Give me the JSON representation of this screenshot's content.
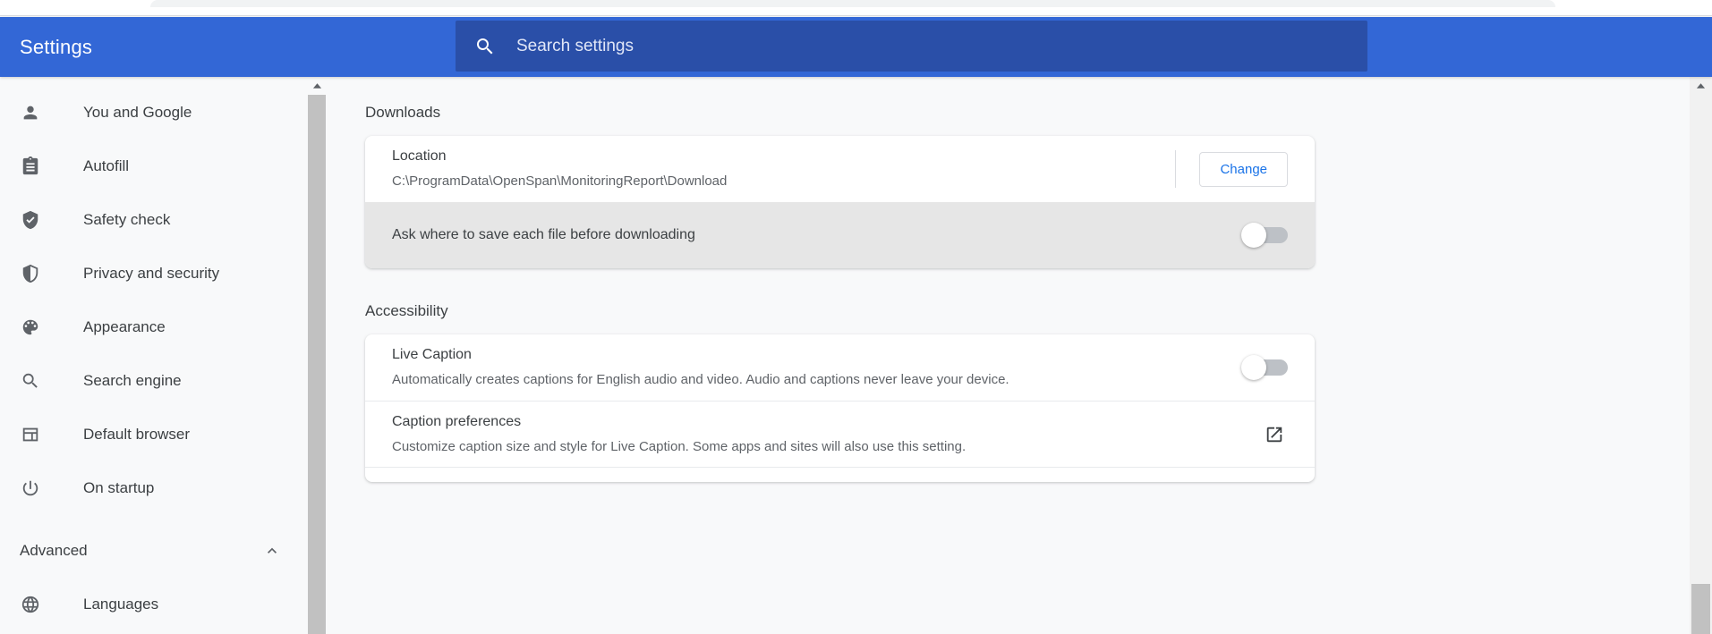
{
  "header": {
    "title": "Settings",
    "search": {
      "placeholder": "Search settings",
      "value": "",
      "icon": "search-icon"
    },
    "background_color": "#3367d6",
    "search_background_color": "#2a4fa8"
  },
  "sidebar": {
    "items": [
      {
        "label": "You and Google",
        "icon": "person-icon"
      },
      {
        "label": "Autofill",
        "icon": "clipboard-icon"
      },
      {
        "label": "Safety check",
        "icon": "shield-check-icon"
      },
      {
        "label": "Privacy and security",
        "icon": "shield-half-icon"
      },
      {
        "label": "Appearance",
        "icon": "palette-icon"
      },
      {
        "label": "Search engine",
        "icon": "search-icon"
      },
      {
        "label": "Default browser",
        "icon": "browser-window-icon"
      },
      {
        "label": "On startup",
        "icon": "power-icon"
      }
    ],
    "group": {
      "label": "Advanced",
      "expanded": true,
      "arrow_icon": "chevron-up-icon"
    },
    "advanced_items": [
      {
        "label": "Languages",
        "icon": "globe-icon"
      }
    ],
    "scrollbar": {
      "up_arrow_icon": "caret-up-icon"
    }
  },
  "main": {
    "downloads": {
      "section_title": "Downloads",
      "location": {
        "title": "Location",
        "path": "C:\\ProgramData\\OpenSpan\\MonitoringReport\\Download",
        "change_button": "Change"
      },
      "ask_where_to_save": {
        "title": "Ask where to save each file before downloading",
        "toggle_state": "off"
      }
    },
    "accessibility": {
      "section_title": "Accessibility",
      "live_caption": {
        "title": "Live Caption",
        "description": "Automatically creates captions for English audio and video. Audio and captions never leave your device.",
        "toggle_state": "off"
      },
      "caption_preferences": {
        "title": "Caption preferences",
        "description": "Customize caption size and style for Live Caption. Some apps and sites will also use this setting.",
        "action_icon": "open-in-new-icon"
      }
    },
    "scrollbar": {
      "up_arrow_icon": "caret-up-icon"
    }
  },
  "colors": {
    "accent_blue": "#1a73e8",
    "header_blue": "#3367d6",
    "page_background": "#f8f9fa",
    "card_background": "#ffffff",
    "text_primary": "#3c4043",
    "text_secondary": "#5f6368"
  }
}
